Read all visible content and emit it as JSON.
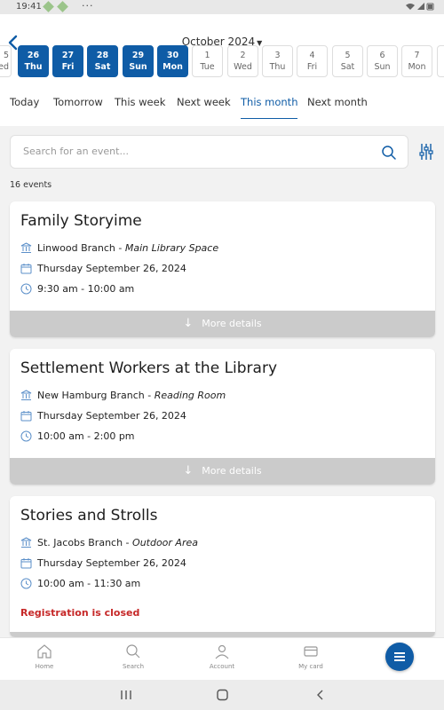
{
  "status_bar": {
    "time": "19:41",
    "more": "···"
  },
  "header": {
    "month_label": "October 2024"
  },
  "days": [
    {
      "num": "26",
      "wd": "Thu",
      "selected": true
    },
    {
      "num": "27",
      "wd": "Fri",
      "selected": true
    },
    {
      "num": "28",
      "wd": "Sat",
      "selected": true
    },
    {
      "num": "29",
      "wd": "Sun",
      "selected": true
    },
    {
      "num": "30",
      "wd": "Mon",
      "selected": true
    },
    {
      "num": "1",
      "wd": "Tue",
      "selected": false
    },
    {
      "num": "2",
      "wd": "Wed",
      "selected": false
    },
    {
      "num": "3",
      "wd": "Thu",
      "selected": false
    },
    {
      "num": "4",
      "wd": "Fri",
      "selected": false
    },
    {
      "num": "5",
      "wd": "Sat",
      "selected": false
    },
    {
      "num": "6",
      "wd": "Sun",
      "selected": false
    },
    {
      "num": "7",
      "wd": "Mon",
      "selected": false
    }
  ],
  "partial_day": {
    "num": "5",
    "wd": "ed"
  },
  "tabs": [
    "Today",
    "Tomorrow",
    "This week",
    "Next week",
    "This month",
    "Next month"
  ],
  "active_tab": "This month",
  "search": {
    "placeholder": "Search for an event..."
  },
  "events_count": "16 events",
  "events": [
    {
      "title": "Family Storyime",
      "branch": "Linwood Branch",
      "room": "Main Library Space",
      "date": "Thursday September 26, 2024",
      "time": "9:30 am - 10:00 am",
      "more": "More details"
    },
    {
      "title": "Settlement Workers at the Library",
      "branch": "New Hamburg Branch",
      "room": "Reading Room",
      "date": "Thursday September 26, 2024",
      "time": "10:00 am - 2:00 pm",
      "more": "More details"
    },
    {
      "title": "Stories and Strolls",
      "branch": "St. Jacobs Branch",
      "room": "Outdoor Area",
      "date": "Thursday September 26, 2024",
      "time": "10:00 am - 11:30 am",
      "notice": "Registration is closed"
    }
  ],
  "bottom_nav": [
    "Home",
    "Search",
    "Account",
    "My card"
  ],
  "colors": {
    "accent": "#0f5ca6",
    "closed": "#c62828",
    "more_bar": "#cbcbcb"
  }
}
